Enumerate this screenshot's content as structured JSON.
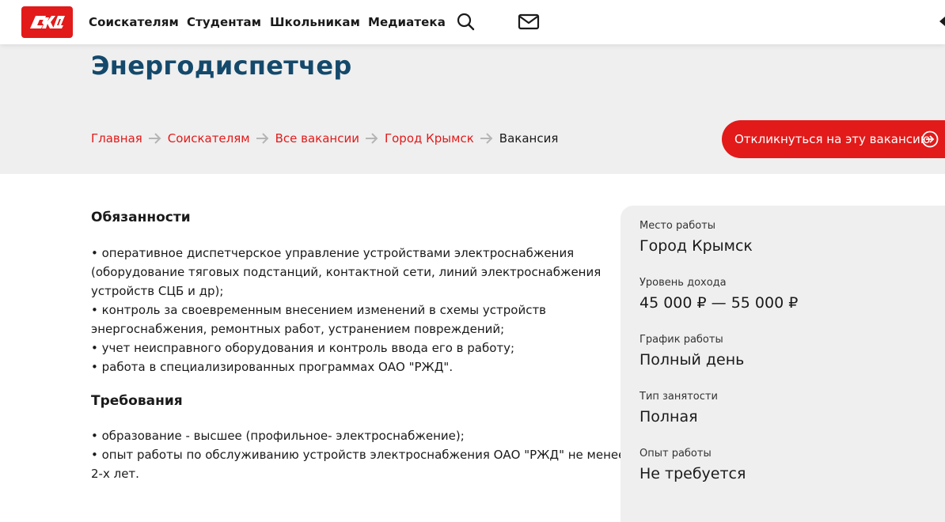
{
  "colors": {
    "brand_red": "#e21a1a",
    "title_blue": "#14496b",
    "band_grey": "#efefef"
  },
  "header": {
    "logo_icon": "rzd-logo-icon",
    "nav": [
      {
        "label": "Соискателям"
      },
      {
        "label": "Студентам"
      },
      {
        "label": "Школьникам"
      },
      {
        "label": "Медиатека"
      }
    ],
    "search_icon": "search-icon",
    "mail_icon": "mail-icon"
  },
  "hero": {
    "title": "Энергодиспетчер",
    "breadcrumb": [
      {
        "label": "Главная"
      },
      {
        "label": "Соискателям"
      },
      {
        "label": "Все вакансии"
      },
      {
        "label": "Город Крымск"
      }
    ],
    "breadcrumb_current": "Вакансия",
    "apply_button": "Откликнуться на эту вакансию"
  },
  "duties": {
    "title": "Обязанности",
    "lines": [
      "• оперативное диспетчерское управление устройствами электроснабжения",
      "(оборудование тяговых подстанций, контактной сети, линий электроснабжения",
      "устройств СЦБ и др);",
      "• контроль за своевременным внесением изменений в схемы устройств",
      "энергоснабжения, ремонтных работ, устранением повреждений;",
      "• учет неисправного оборудования и контроль ввода его в работу;",
      "• работа в специализированных программах ОАО \"РЖД\"."
    ]
  },
  "requirements": {
    "title": "Требования",
    "lines": [
      "• образование - высшее (профильное- электроснабжение);",
      "• опыт работы по обслуживанию устройств электроснабжения ОАО \"РЖД\" не менее",
      "2-х лет."
    ]
  },
  "info": [
    {
      "label": "Место работы",
      "value": "Город Крымск"
    },
    {
      "label": "Уровень дохода",
      "value": "45 000 ₽ — 55 000 ₽"
    },
    {
      "label": "График работы",
      "value": "Полный день"
    },
    {
      "label": "Тип занятости",
      "value": "Полная"
    },
    {
      "label": "Опыт работы",
      "value": "Не требуется"
    }
  ]
}
